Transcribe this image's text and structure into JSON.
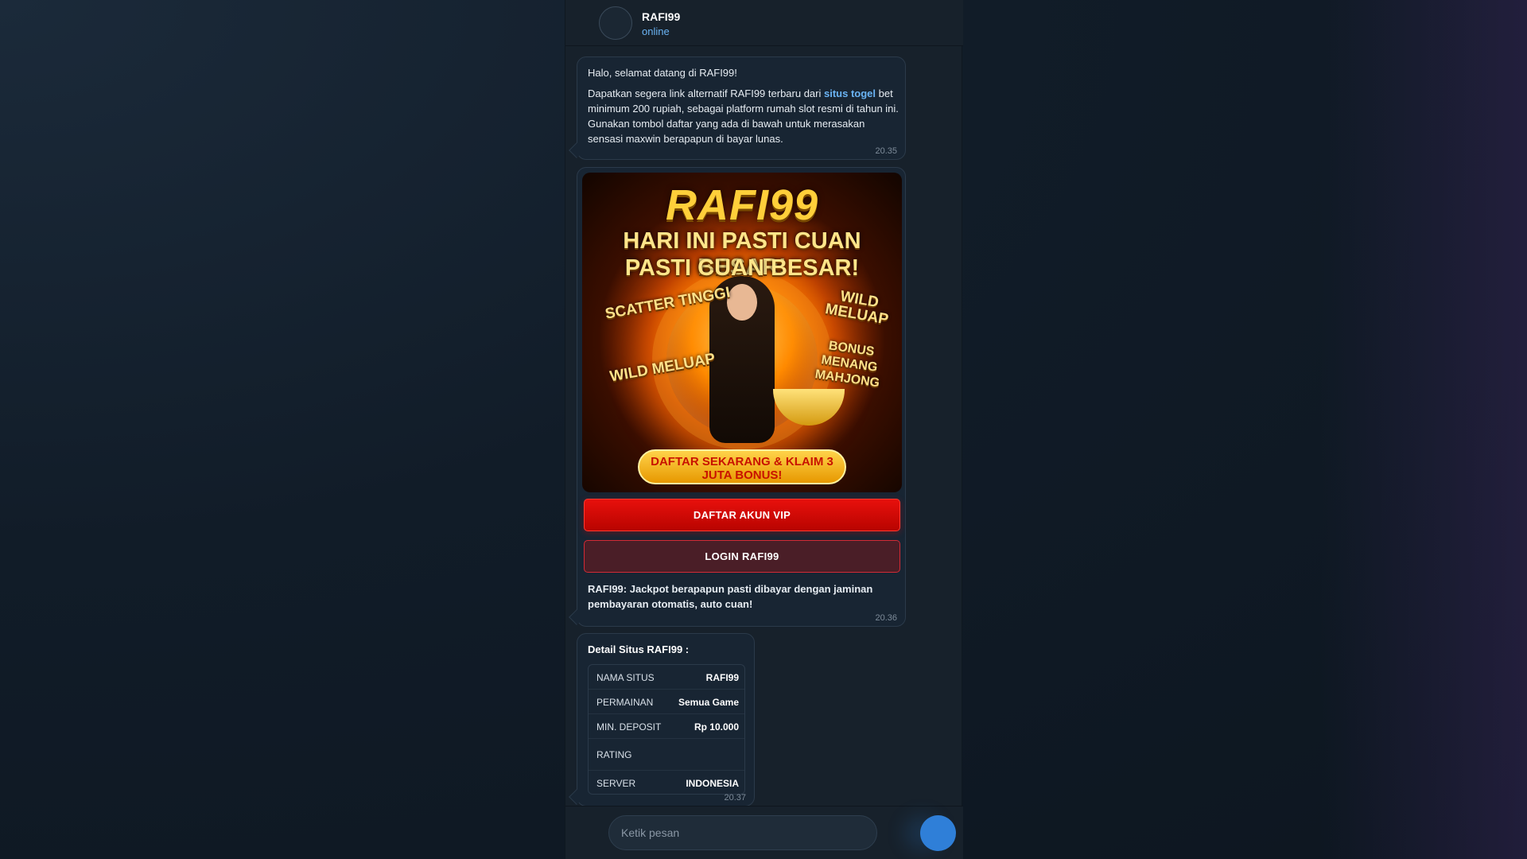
{
  "header": {
    "name": "RAFI99",
    "status": "online"
  },
  "messages": {
    "welcome": {
      "greeting": "Halo, selamat datang di RAFI99!",
      "para_before": "Dapatkan segera link alternatif RAFI99 terbaru dari ",
      "link_text": "situs togel",
      "para_after": " bet minimum 200 rupiah, sebagai platform rumah slot resmi di tahun ini. Gunakan tombol daftar yang ada di bawah untuk merasakan sensasi maxwin berapapun di bayar lunas.",
      "time": "20.35"
    },
    "promo": {
      "banner": {
        "logo": "RAFI99",
        "line1": "HARI INI PASTI CUAN BESAR!",
        "line2": "PASTI CUAN BESAR!",
        "tag_scatter": "SCATTER TINGGI",
        "tag_wild_right": "WILD MELUAP",
        "tag_bonus": "BONUS MENANG MAHJONG",
        "tag_wild_left": "WILD MELUAP",
        "cta": "DAFTAR SEKARANG & KLAIM 3 JUTA BONUS!"
      },
      "btn_register": "DAFTAR AKUN VIP",
      "btn_login": "LOGIN RAFI99",
      "caption": "RAFI99: Jackpot berapapun pasti dibayar dengan jaminan pembayaran otomatis, auto cuan!",
      "time": "20.36"
    },
    "details": {
      "title": "Detail Situs RAFI99 :",
      "rows": [
        {
          "key": "NAMA SITUS",
          "value": "RAFI99"
        },
        {
          "key": "PERMAINAN",
          "value": "Semua Game"
        },
        {
          "key": "MIN. DEPOSIT",
          "value": "Rp 10.000"
        },
        {
          "key": "RATING",
          "value": ""
        },
        {
          "key": "SERVER",
          "value": "INDONESIA"
        }
      ],
      "time": "20.37"
    }
  },
  "composer": {
    "placeholder": "Ketik pesan"
  },
  "colors": {
    "accent_blue": "#6ab3f3",
    "send_button": "#2f7fd8",
    "vip_red": "#e8100c",
    "bubble_bg": "#182533"
  }
}
